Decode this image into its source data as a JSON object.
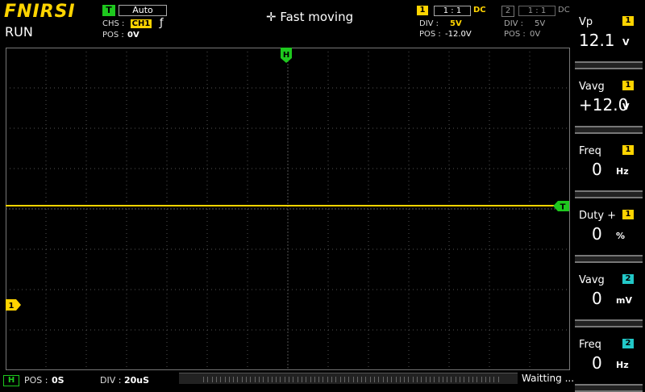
{
  "brand": "FNIRSI",
  "run_state": "RUN",
  "trigger": {
    "badge": "T",
    "mode": "Auto",
    "chs_label": "CHS :",
    "chs_value": "CH1",
    "edge_icon": "rising-edge-icon",
    "edge_glyph": "ƒ",
    "pos_label": "POS :",
    "pos_value": "0V"
  },
  "title": {
    "icon": "move-arrows-icon",
    "icon_glyph": "✛",
    "text": "Fast moving"
  },
  "ch1": {
    "badge": "1",
    "ratio": "1 : 1",
    "coupling": "DC",
    "div_label": "DIV :",
    "div_value": "5V",
    "pos_label": "POS :",
    "pos_value": "-12.0V",
    "color": "#ffd400"
  },
  "ch2": {
    "badge": "2",
    "ratio": "1 : 1",
    "coupling": "DC",
    "div_label": "DIV :",
    "div_value": "5V",
    "pos_label": "POS :",
    "pos_value": "0V",
    "color": "#22c8c8"
  },
  "markers": {
    "h": "H",
    "t": "T",
    "ch1": "1"
  },
  "measurements": [
    {
      "label": "Vp",
      "ch": "1",
      "value": "12.1",
      "unit": "V",
      "color": "#ffd400"
    },
    {
      "label": "Vavg",
      "ch": "1",
      "value": "+12.0",
      "unit": "V",
      "color": "#ffd400"
    },
    {
      "label": "Freq",
      "ch": "1",
      "value": "0",
      "unit": "Hz",
      "color": "#ffd400"
    },
    {
      "label": "Duty +",
      "ch": "1",
      "value": "0",
      "unit": "%",
      "color": "#ffd400"
    },
    {
      "label": "Vavg",
      "ch": "2",
      "value": "0",
      "unit": "mV",
      "color": "#22c8c8"
    },
    {
      "label": "Freq",
      "ch": "2",
      "value": "0",
      "unit": "Hz",
      "color": "#22c8c8"
    }
  ],
  "bottom": {
    "h_badge": "H",
    "pos_label": "POS :",
    "pos_value": "0S",
    "div_label": "DIV :",
    "div_value": "20uS",
    "status": "Waitting ..."
  },
  "colors": {
    "grid": "#555555",
    "trace": "#ffd400",
    "trigger": "#1ec81e",
    "frame": "#777777"
  }
}
